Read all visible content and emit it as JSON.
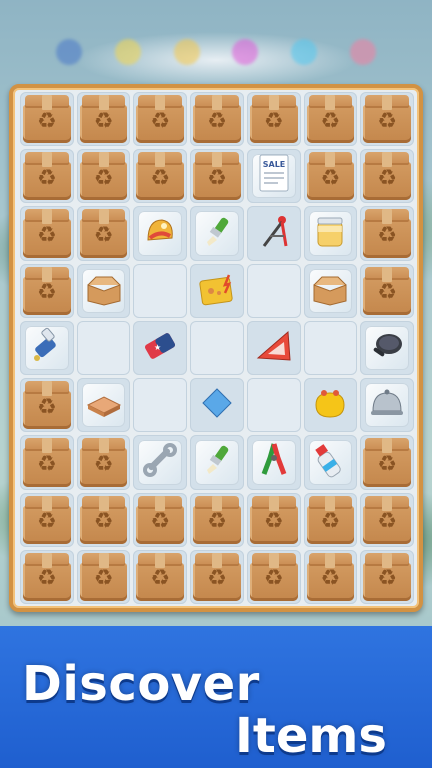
{
  "promo": {
    "line1": "Discover",
    "line2": "Items"
  },
  "top_bar": {
    "dots": [
      {
        "icon": "globe-icon",
        "color": "#4a78c8"
      },
      {
        "icon": "coin-icon",
        "color": "#f3d64e"
      },
      {
        "icon": "coin-icon",
        "color": "#f5c84a"
      },
      {
        "icon": "gem-icon",
        "color": "#e05ad8"
      },
      {
        "icon": "gem-icon",
        "color": "#52c8f0"
      },
      {
        "icon": "gem-icon",
        "color": "#f37ea0"
      }
    ]
  },
  "board": {
    "columns": 7,
    "rows": 9,
    "cells": [
      [
        "box",
        "box",
        "box",
        "box",
        "box",
        "box",
        "box"
      ],
      [
        "box",
        "box",
        "box",
        "box",
        "receipt",
        "box",
        "box"
      ],
      [
        "box",
        "box",
        "helmet",
        "paintbrush-green",
        "drafting-compass",
        "jar",
        "box"
      ],
      [
        "box",
        "open-box",
        "empty",
        "sketchbook",
        "empty",
        "open-box",
        "box"
      ],
      [
        "flashlight",
        "empty",
        "eraser",
        "empty",
        "set-square",
        "empty",
        "frying-pan"
      ],
      [
        "box",
        "wooden-block",
        "empty",
        "blue-tile",
        "empty",
        "coin-purse",
        "cloche"
      ],
      [
        "box",
        "box",
        "wrench",
        "paintbrush-green",
        "pliers",
        "spray-bottle",
        "box"
      ],
      [
        "box",
        "box",
        "box",
        "box",
        "box",
        "box",
        "box"
      ],
      [
        "box",
        "box",
        "box",
        "box",
        "box",
        "box",
        "box"
      ]
    ],
    "receipt_text": "SALE"
  },
  "colors": {
    "board_border": "#d29243",
    "promo_bg": "#1f5fcf",
    "box": "#c98c52"
  }
}
